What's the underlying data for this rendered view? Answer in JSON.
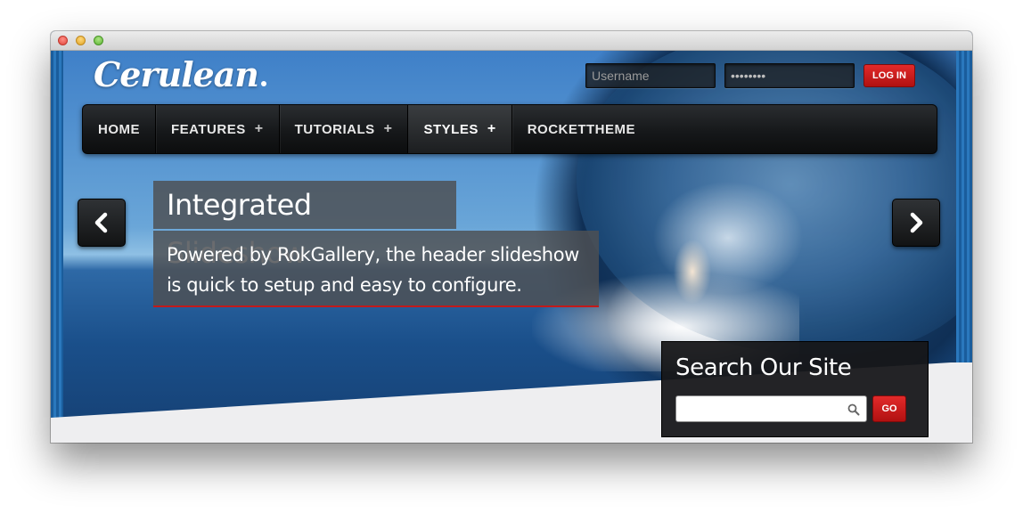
{
  "site": {
    "logo_text": "Cerulean"
  },
  "login": {
    "username_placeholder": "Username",
    "password_placeholder": "Password",
    "password_value": "password",
    "button_label": "LOG IN"
  },
  "nav": {
    "items": [
      {
        "label": "HOME",
        "has_submenu": false,
        "active": false
      },
      {
        "label": "FEATURES",
        "has_submenu": true,
        "active": false,
        "submenu_icon": "+"
      },
      {
        "label": "TUTORIALS",
        "has_submenu": true,
        "active": false,
        "submenu_icon": "+"
      },
      {
        "label": "STYLES",
        "has_submenu": true,
        "active": true,
        "submenu_icon": "+"
      },
      {
        "label": "ROCKETTHEME",
        "has_submenu": false,
        "active": false
      }
    ]
  },
  "slideshow": {
    "title": "Integrated Slideshow",
    "description": "Powered by RokGallery, the header slideshow is quick to setup and easy to configure.",
    "prev_icon": "chevron-left-icon",
    "next_icon": "chevron-right-icon"
  },
  "search": {
    "title": "Search Our Site",
    "input_value": "",
    "icon": "search-icon",
    "button_label": "GO"
  },
  "colors": {
    "accent": "#c41a1a",
    "nav_bg": "#1a1c1e",
    "overlay": "#4e5054"
  }
}
